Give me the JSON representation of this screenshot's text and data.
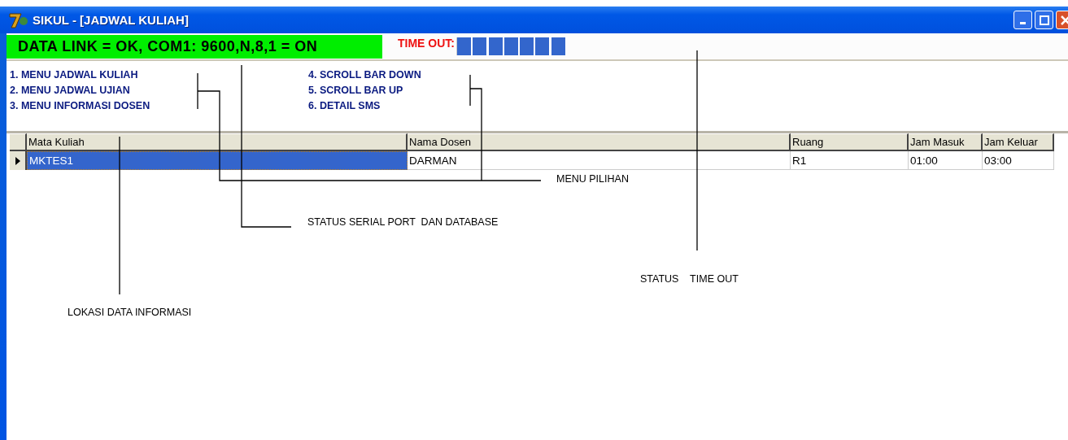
{
  "window": {
    "title": "SIKUL - [JADWAL KULIAH]"
  },
  "status": {
    "data_link": "DATA LINK = OK, COM1: 9600,N,8,1 = ON",
    "timeout_label": "TIME OUT:",
    "timeout": {
      "level": 0.5
    }
  },
  "menu": {
    "items": [
      {
        "label": "1. MENU JADWAL KULIAH"
      },
      {
        "label": "2. MENU JADWAL UJIAN"
      },
      {
        "label": "3. MENU INFORMASI DOSEN"
      },
      {
        "label": "4. SCROLL BAR DOWN"
      },
      {
        "label": "5. SCROLL BAR UP"
      },
      {
        "label": "6. DETAIL SMS"
      }
    ]
  },
  "table": {
    "columns": [
      "Mata Kuliah",
      "Nama Dosen",
      "Ruang",
      "Jam Masuk",
      "Jam Keluar"
    ],
    "rows": [
      {
        "selected": true,
        "cells": [
          "MKTES1",
          "DARMAN",
          "R1",
          "01:00",
          "03:00"
        ]
      }
    ]
  },
  "annotations": [
    {
      "label": "MENU PILIHAN"
    },
    {
      "label": "STATUS SERIAL PORT  DAN DATABASE"
    },
    {
      "label": "STATUS    TIME OUT"
    },
    {
      "label": "LOKASI DATA INFORMASI"
    }
  ]
}
